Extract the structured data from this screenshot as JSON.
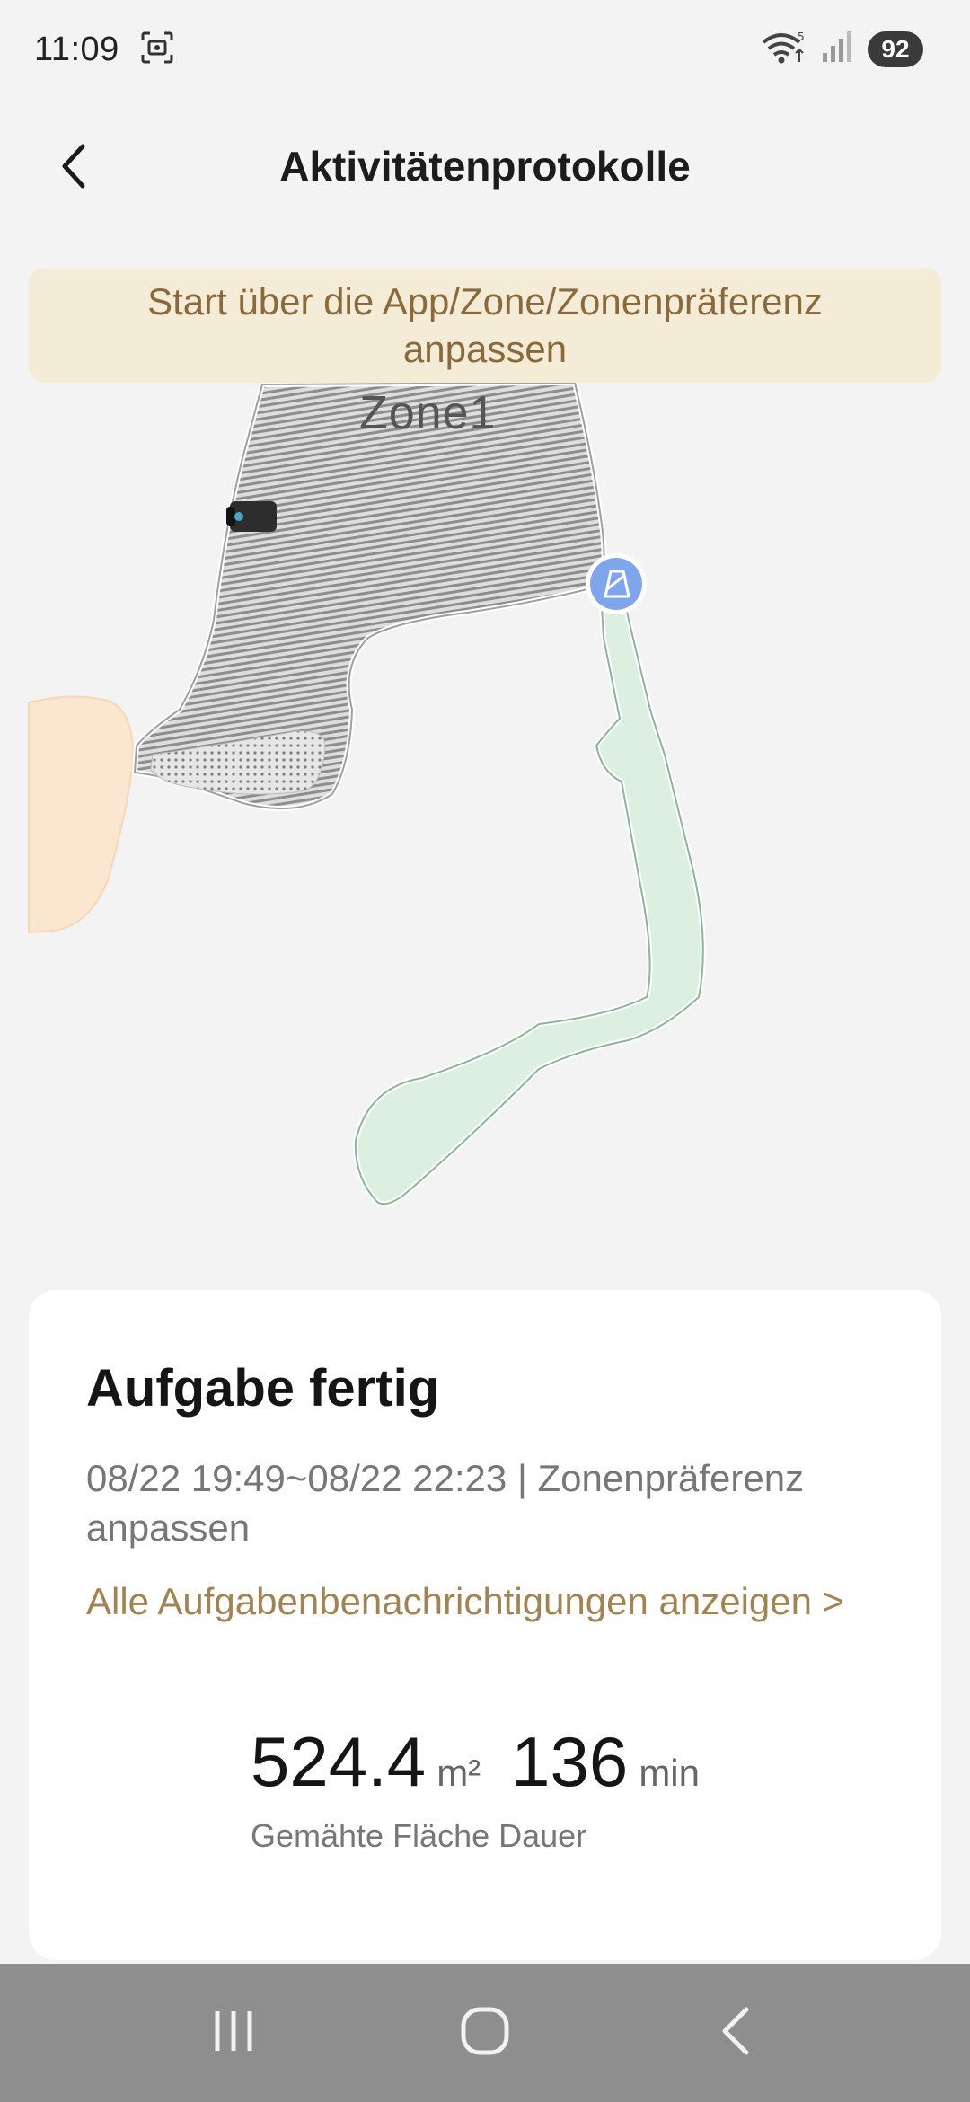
{
  "status_bar": {
    "time": "11:09",
    "battery": "92",
    "icons": [
      "screenshot-icon",
      "wifi-icon",
      "signal-icon"
    ]
  },
  "header": {
    "title": "Aktivitätenprotokolle",
    "back_icon": "chevron-left-icon"
  },
  "banner": {
    "text": "Start über die App/Zone/Zonenpräferenz anpassen"
  },
  "map": {
    "zone_label": "Zone1",
    "colors": {
      "mowed_zone": "#e0e0e0",
      "stripes": "#8a8a8a",
      "green_path": "#dcefe1",
      "orange_area": "#fbe6cf",
      "station_marker": "#7fa6ec"
    }
  },
  "card": {
    "title": "Aufgabe fertig",
    "subtitle": "08/22 19:49~08/22 22:23 | Zonenpräferenz anpassen",
    "link": "Alle Aufgabenbenachrichtigungen anzeigen >",
    "area_value": "524.4",
    "area_unit": "m²",
    "duration_value": "136",
    "duration_unit": "min",
    "labels": "Gemähte Fläche Dauer"
  },
  "nav_bar": {
    "icons": [
      "recent-apps-icon",
      "home-icon",
      "back-icon"
    ]
  }
}
